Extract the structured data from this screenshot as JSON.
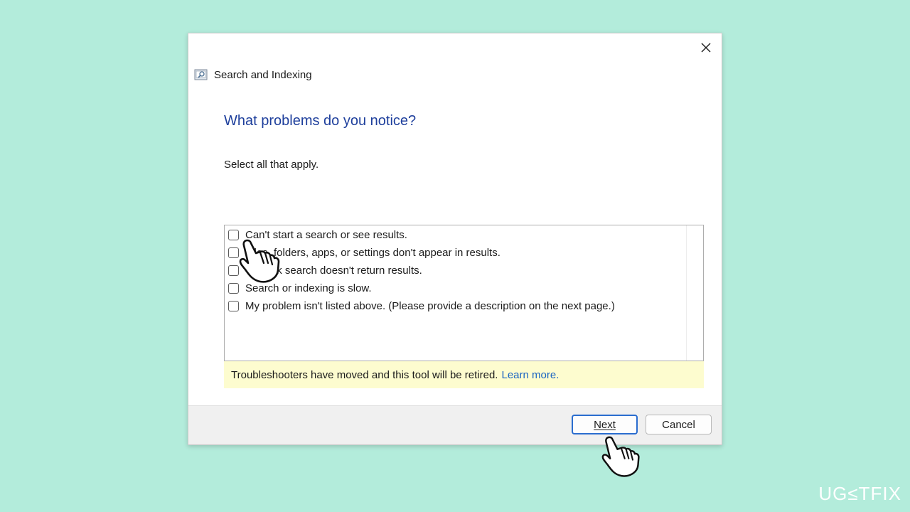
{
  "window": {
    "app_title": "Search and Indexing",
    "close_icon": "close-icon",
    "app_icon": "search-indexing-icon"
  },
  "content": {
    "heading": "What problems do you notice?",
    "subtext": "Select all that apply.",
    "options": [
      {
        "label": "Can't start a search or see results.",
        "checked": false
      },
      {
        "label": "Files, folders, apps, or settings don't appear in results.",
        "checked": false
      },
      {
        "label": "Outlook search doesn't return results.",
        "checked": false
      },
      {
        "label": "Search or indexing is slow.",
        "checked": false
      },
      {
        "label": "My problem isn't listed above. (Please provide a description on the next page.)",
        "checked": false
      }
    ],
    "notice_text": "Troubleshooters have moved and this tool will be retired.",
    "notice_link": "Learn more."
  },
  "footer": {
    "next_label": "Next",
    "cancel_label": "Cancel"
  },
  "watermark": {
    "text_prefix": "UG",
    "text_mid": "≤T",
    "text_suffix": "FIX"
  },
  "colors": {
    "background": "#b3ecdb",
    "heading": "#1e3f9c",
    "link": "#1a64c2",
    "notice_bg": "#fdfccf",
    "focus_border": "#2a6dcf"
  }
}
